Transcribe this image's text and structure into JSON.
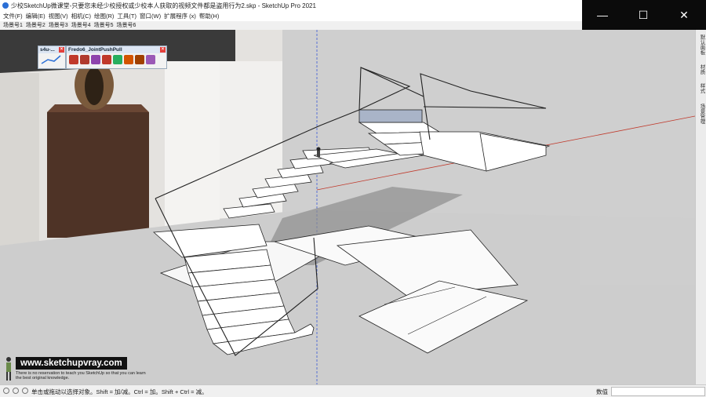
{
  "window": {
    "title": "少校SketchUp微课堂-只要您未经少校授权或少校本人获取的视频文件都是盗用行为2.skp - SketchUp Pro 2021",
    "controls": {
      "minimize": "—",
      "maximize": "☐",
      "close": "✕"
    }
  },
  "menu": [
    "文件(F)",
    "编辑(E)",
    "视图(V)",
    "相机(C)",
    "绘图(R)",
    "工具(T)",
    "窗口(W)",
    "扩展程序 (x)",
    "帮助(H)"
  ],
  "scenes": [
    "场景号1",
    "场景号2",
    "场景号3",
    "场景号4",
    "场景号5",
    "场景号6"
  ],
  "toolbars": {
    "s4u": {
      "title": "s4u-..."
    },
    "fredo": {
      "title": "Fredo6_JointPushPull",
      "button_colors": [
        "#c0392b",
        "#b03a2e",
        "#8e44ad",
        "#c0392b",
        "#27ae60",
        "#d35400",
        "#a04000",
        "#9b59b6"
      ]
    }
  },
  "right_dock": [
    "默认面板",
    "材质",
    "样式",
    "场景管理"
  ],
  "watermark": {
    "url": "www.sketchupvray.com",
    "line1": "There is no reservation to teach you SketchUp so that you can learn",
    "line2": "the best original knowledge."
  },
  "status": {
    "message": "单击或拖动以选择对象。Shift = 加/减。Ctrl = 加。Shift + Ctrl = 减。",
    "measure_label": "数值",
    "measure_value": ""
  },
  "colors": {
    "accent": "#2b6fd6",
    "axis_red": "#c0392b",
    "axis_blue": "#3b5bd6"
  }
}
